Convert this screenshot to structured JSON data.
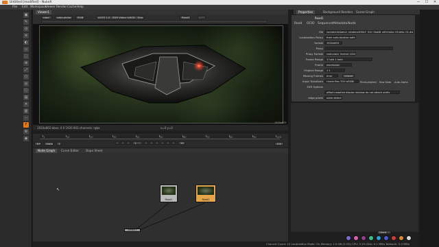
{
  "window": {
    "title": "Untitled [modified] - NukeX",
    "minimize": "—",
    "maximize": "☐",
    "close": "✕"
  },
  "menubar": [
    "File",
    "Edit",
    "Workspace",
    "Viewer",
    "Render",
    "Cache",
    "Help"
  ],
  "viewer": {
    "tab": "Viewer1",
    "channels": "rgba",
    "alpha": "rgba.alpha",
    "colorspace": "RGB",
    "lut": "ACES 1.0 - SDR Video (sRGB - Display)",
    "input_a": "Read1",
    "input_b": "-",
    "info_left": "1920x803 bbox: 0 0 1920 803 channels: rgba",
    "info_right": "x=0 y=0",
    "resolution_label": "1920x803"
  },
  "timeline": {
    "fps": "30*",
    "global": "Global",
    "start": "1",
    "end": "100",
    "ticks": [
      "1",
      "10",
      "20",
      "30",
      "40",
      "50",
      "60",
      "70",
      "80",
      "90",
      "100"
    ],
    "frame": "1",
    "increment": "10"
  },
  "dag": {
    "tabs": [
      "Node Graph",
      "Curve Editor",
      "Dope Sheet"
    ],
    "nodes": [
      {
        "name": "Read1",
        "sub": "IO_Ship_...(E)"
      },
      {
        "name": "Read2",
        "sub": "IO_Ship_...(E)"
      },
      {
        "name": "Viewer1",
        "sub": ""
      }
    ]
  },
  "properties": {
    "panel_tabs": [
      "Properties",
      "Background Renders",
      "Scene Graph"
    ],
    "node_name": "Read1",
    "tabs": [
      "Read",
      "OCIO",
      "Sequence",
      "Metadata",
      "Node"
    ],
    "rows": [
      {
        "label": "file",
        "value": "/scratch/shipmyr_renders/IOS/LT_S10_ShotB_v001/ship_01/ship_01.####.exr"
      },
      {
        "label": "Localization Policy",
        "value": "from auto-localize path"
      },
      {
        "label": "format",
        "value": "1920x803"
      },
      {
        "label": "Proxy",
        "value": ""
      },
      {
        "label": "Proxy Format",
        "value": "root.proxy_format 1024x778"
      },
      {
        "label": "Frame Range",
        "value": "1   hold   1   hold"
      },
      {
        "label": "Frame",
        "value": "expression"
      },
      {
        "label": "Original Range",
        "value": "1   1"
      },
      {
        "label": "Missing Frames",
        "value": "error"
      },
      {
        "label": "Input Transform",
        "value": "Linear Rec.709 (sRGB)"
      },
      {
        "label": "EXR Options",
        "value": ""
      },
      {
        "label": "",
        "value": "offset negative display window   do not attach prefix"
      },
      {
        "label": "edge pixels",
        "value": "plate detect"
      }
    ],
    "premultiplied": "Premultiplied",
    "raw_data": "Raw Data",
    "auto_alpha": "Auto Alpha",
    "reload": "reload"
  },
  "swatches": [
    "#7b6ad6",
    "#d85fb0",
    "#8f3f8f",
    "#3cc28a",
    "#2f9fd8",
    "#4b5bd1",
    "#cf3a3a",
    "#d98a2a",
    "#d9d9d9"
  ],
  "status": "Channel Count: 10  Localization Mode: On  Memory: 1.0 GB (3.4%)  CPU: 3.1%  Disk: 0.1 MB/s  Network: 0.0 MB/s",
  "zoom": "Liked"
}
